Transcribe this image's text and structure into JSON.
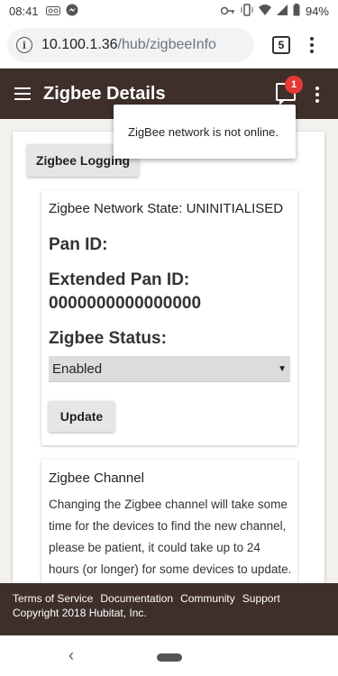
{
  "status_bar": {
    "time": "08:41",
    "battery": "94%"
  },
  "browser": {
    "url_host": "10.100.1.36",
    "url_path": "/hub/zigbeeInfo",
    "tab_count": "5"
  },
  "app_bar": {
    "title": "Zigbee Details",
    "notification_count": "1"
  },
  "popup": {
    "message": "ZigBee network is not online."
  },
  "buttons": {
    "logging": "Zigbee Logging",
    "update": "Update"
  },
  "network": {
    "state_label": "Zigbee Network State: UNINITIALISED",
    "pan_id_label": "Pan ID:",
    "ext_pan_id_label": "Extended Pan ID:",
    "ext_pan_id_value": "0000000000000000",
    "status_label": "Zigbee Status:",
    "status_selected": "Enabled"
  },
  "channel": {
    "title": "Zigbee Channel",
    "text": "Changing the Zigbee channel will take some time for the devices to find the new channel, please be patient, it could take up to 24 hours (or longer) for some devices to update."
  },
  "footer": {
    "links": [
      "Terms of Service",
      "Documentation",
      "Community",
      "Support"
    ],
    "copyright": "Copyright 2018 Hubitat, Inc."
  },
  "colors": {
    "app_bar": "#3e2f2a",
    "badge": "#e53935",
    "page_bg": "#f3f1ee"
  }
}
